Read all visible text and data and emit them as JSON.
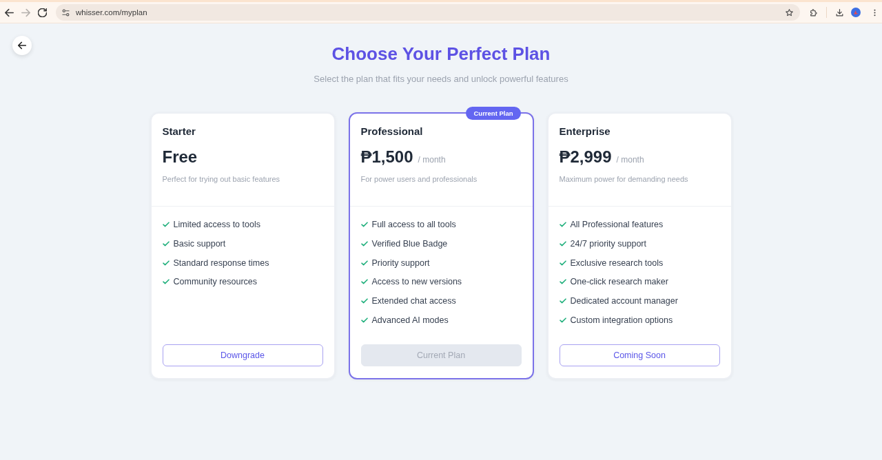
{
  "browser": {
    "nav": [
      {
        "kind": "back",
        "disabled": false
      },
      {
        "kind": "forward",
        "disabled": true
      },
      {
        "kind": "reload",
        "disabled": false
      }
    ],
    "url": "whisser.com/myplan"
  },
  "header": {
    "title": "Choose Your Perfect Plan",
    "subtitle": "Select the plan that fits your needs and unlock powerful features"
  },
  "plans": [
    {
      "name": "Starter",
      "price": "Free",
      "description": "Perfect for trying out basic features",
      "features": [
        "Limited access to tools",
        "Basic support",
        "Standard response times",
        "Community resources"
      ],
      "button": {
        "label": "Downgrade",
        "disabled": false
      },
      "current": false
    },
    {
      "name": "Professional",
      "price": "₱1,500",
      "period": "/ month",
      "description": "For power users and professionals",
      "badge": "Current Plan",
      "features": [
        "Full access to all tools",
        "Verified Blue Badge",
        "Priority support",
        "Access to new versions",
        "Extended chat access",
        "Advanced AI modes"
      ],
      "button": {
        "label": "Current Plan",
        "disabled": true
      },
      "current": true
    },
    {
      "name": "Enterprise",
      "price": "₱2,999",
      "period": "/ month",
      "description": "Maximum power for demanding needs",
      "features": [
        "All Professional features",
        "24/7 priority support",
        "Exclusive research tools",
        "One-click research maker",
        "Dedicated account manager",
        "Custom integration options"
      ],
      "button": {
        "label": "Coming Soon",
        "disabled": false
      },
      "current": false
    }
  ]
}
